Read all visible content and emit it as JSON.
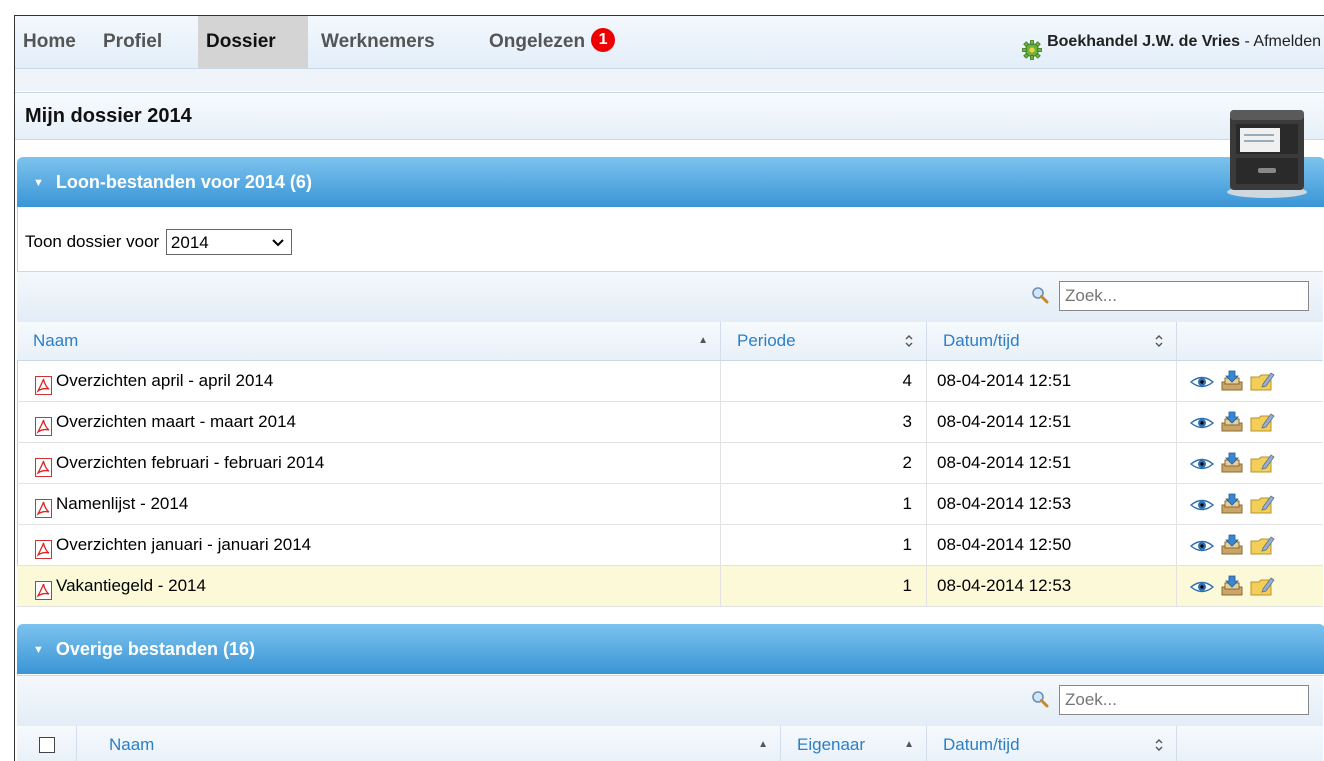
{
  "nav": {
    "items": [
      {
        "label": "Home"
      },
      {
        "label": "Profiel"
      },
      {
        "label": "Dossier"
      },
      {
        "label": "Werknemers"
      },
      {
        "label": "Ongelezen"
      }
    ],
    "unread_badge": "1",
    "company": "Boekhandel J.W. de Vries",
    "separator": " - ",
    "logout": "Afmelden"
  },
  "page": {
    "title": "Mijn dossier 2014"
  },
  "loon_section": {
    "title": "Loon-bestanden voor 2014 (6)",
    "filter_label": "Toon dossier voor",
    "year_selected": "2014",
    "search_placeholder": "Zoek...",
    "columns": {
      "naam": "Naam",
      "periode": "Periode",
      "datum": "Datum/tijd"
    },
    "rows": [
      {
        "naam": "Overzichten april - april 2014",
        "periode": "4",
        "datum": "08-04-2014 12:51"
      },
      {
        "naam": "Overzichten maart - maart 2014",
        "periode": "3",
        "datum": "08-04-2014 12:51"
      },
      {
        "naam": "Overzichten februari - februari 2014",
        "periode": "2",
        "datum": "08-04-2014 12:51"
      },
      {
        "naam": "Namenlijst - 2014",
        "periode": "1",
        "datum": "08-04-2014 12:53"
      },
      {
        "naam": "Overzichten januari - januari 2014",
        "periode": "1",
        "datum": "08-04-2014 12:50"
      },
      {
        "naam": "Vakantiegeld - 2014",
        "periode": "1",
        "datum": "08-04-2014 12:53"
      }
    ]
  },
  "overige_section": {
    "title": "Overige bestanden (16)",
    "search_placeholder": "Zoek...",
    "columns": {
      "naam": "Naam",
      "eigenaar": "Eigenaar",
      "datum": "Datum/tijd"
    }
  },
  "icons": {
    "gear": "gear-icon",
    "cabinet": "file-cabinet-icon",
    "search": "magnifier-icon",
    "pdf": "pdf-icon",
    "view": "eye-icon",
    "download": "download-icon",
    "edit": "edit-folder-icon"
  },
  "colors": {
    "section_bar": "#3a95d6",
    "header_text": "#2b7fc7",
    "highlight_row": "#fbf9d8",
    "badge": "#ee0000"
  }
}
